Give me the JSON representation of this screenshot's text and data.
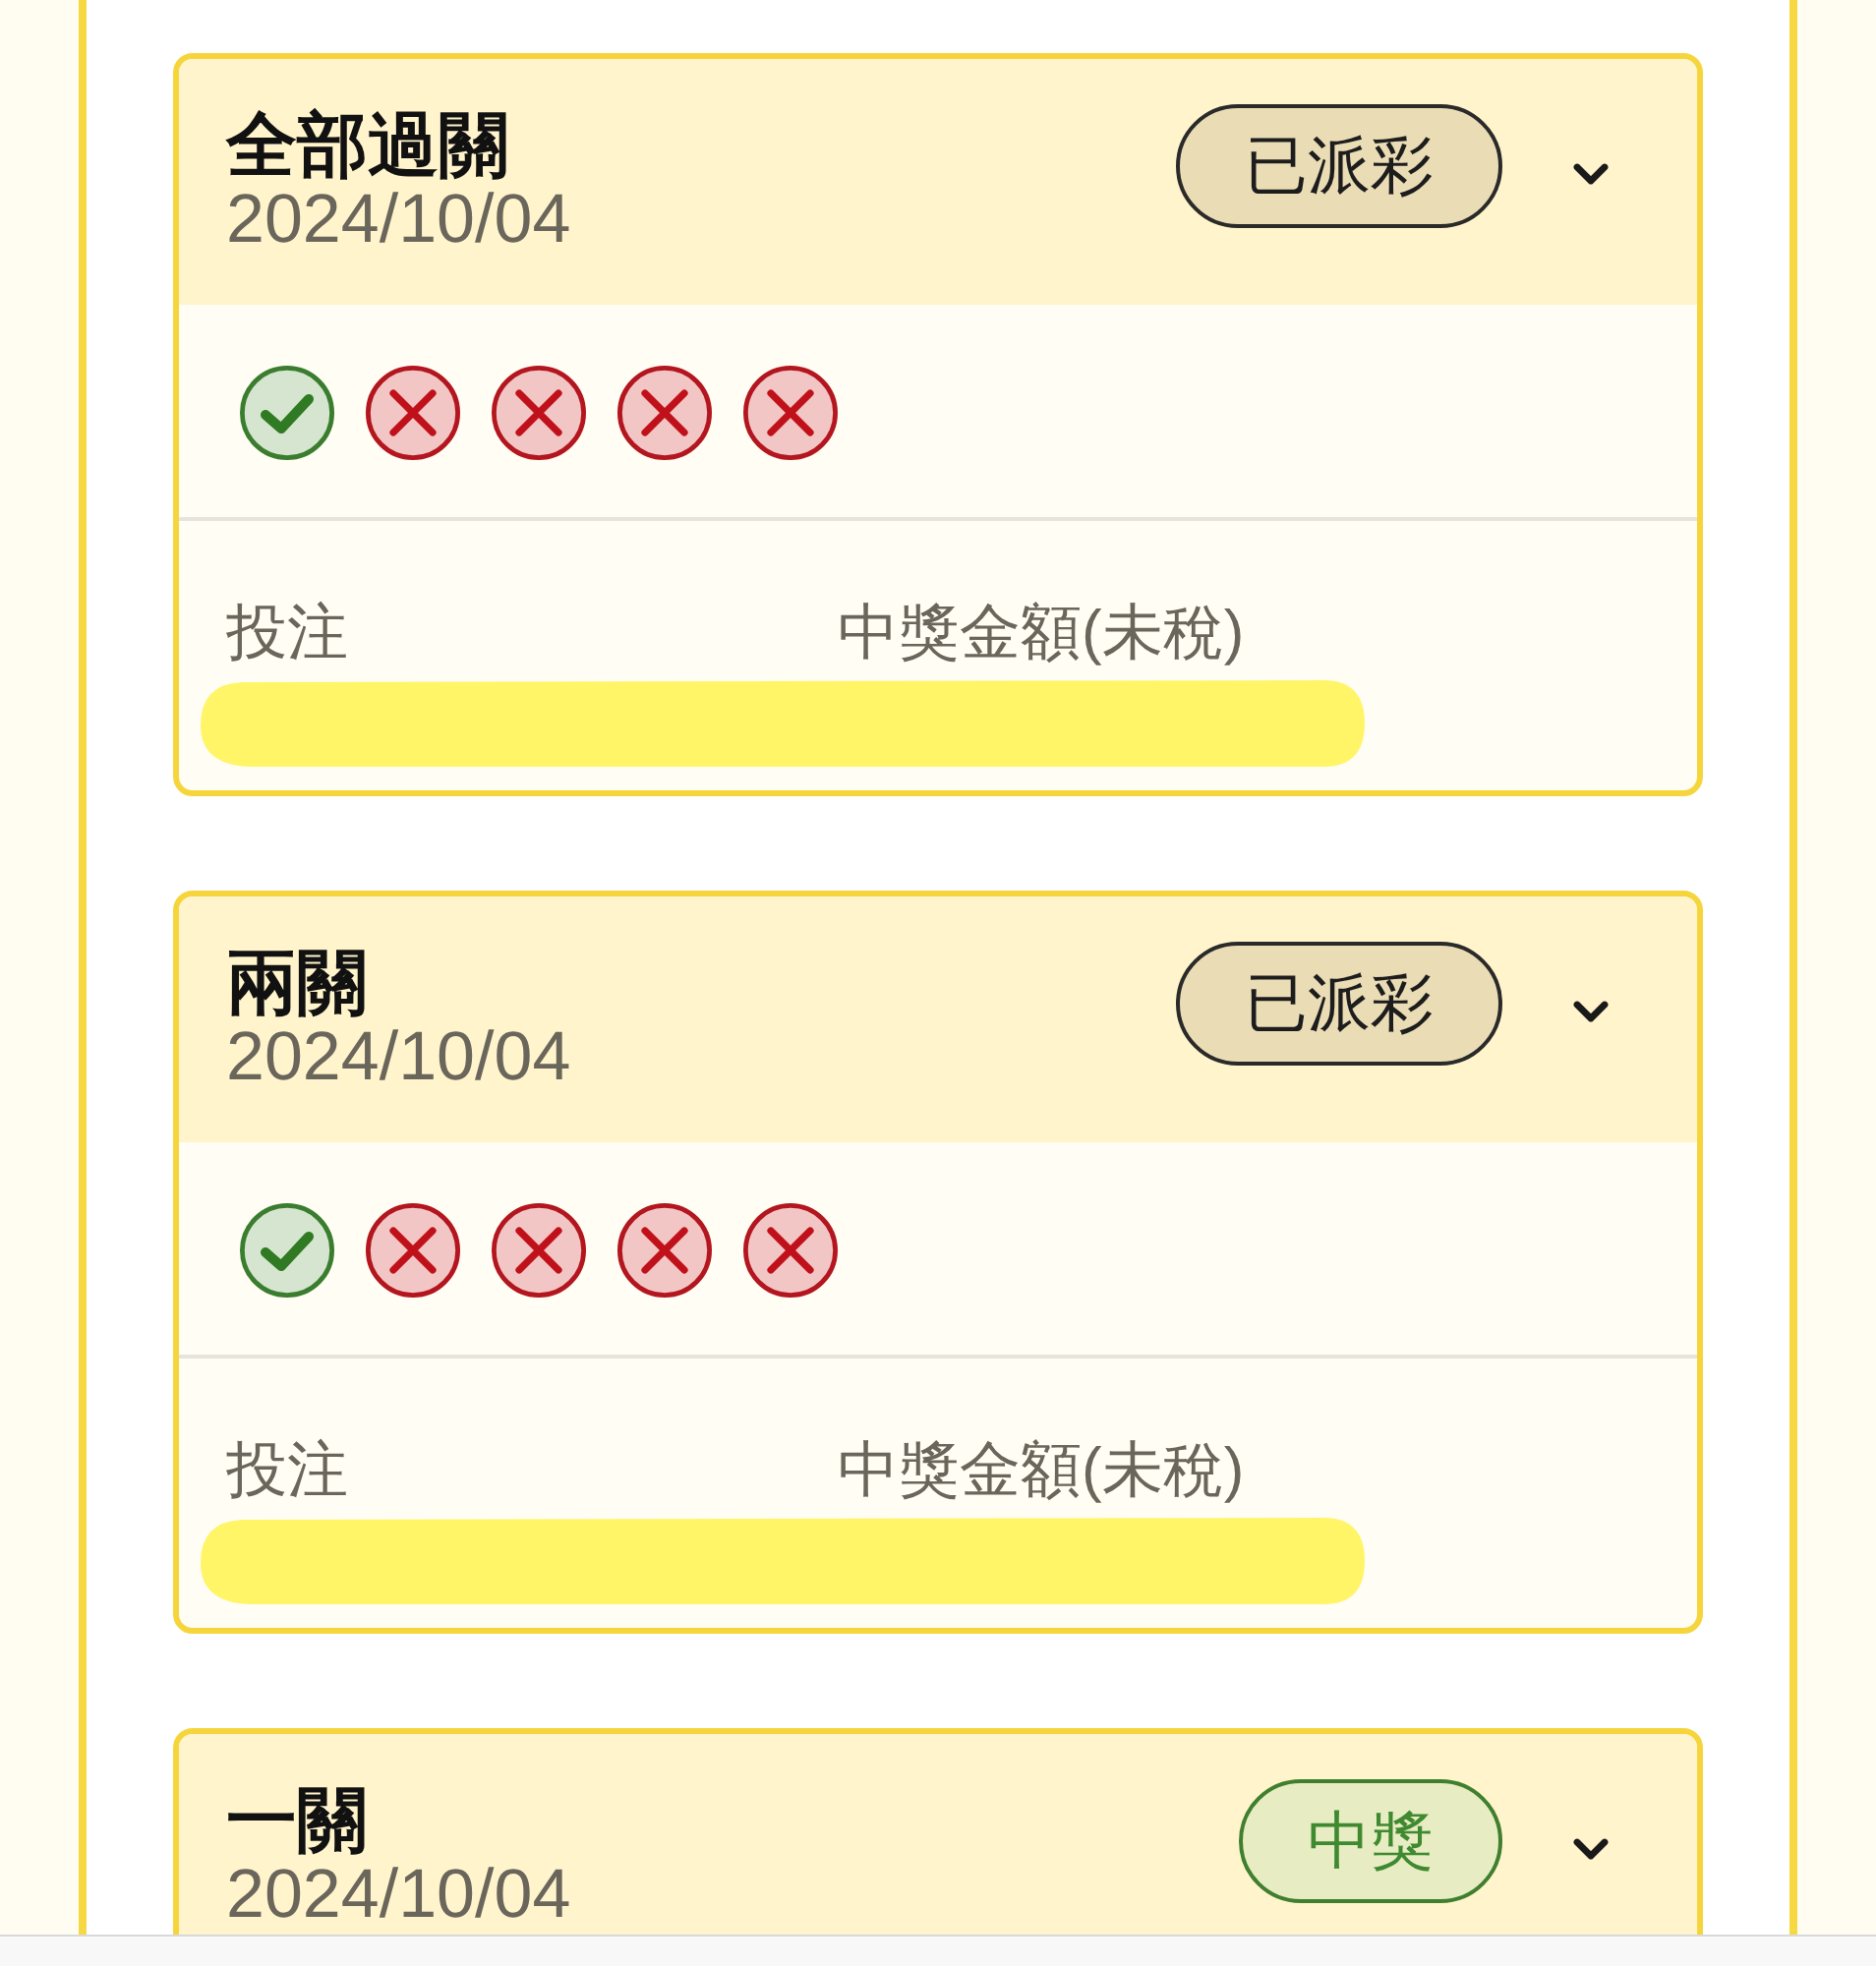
{
  "bets": [
    {
      "title": "全部過關",
      "date": "2024/10/04",
      "status": {
        "kind": "paid",
        "label": "已派彩"
      },
      "legs": [
        {
          "kind": "win"
        },
        {
          "kind": "lose"
        },
        {
          "kind": "lose"
        },
        {
          "kind": "lose"
        },
        {
          "kind": "lose"
        }
      ],
      "columns": [
        "投注",
        "中獎金額(未稅)"
      ]
    },
    {
      "title": "兩關",
      "date": "2024/10/04",
      "status": {
        "kind": "paid",
        "label": "已派彩"
      },
      "legs": [
        {
          "kind": "win"
        },
        {
          "kind": "lose"
        },
        {
          "kind": "lose"
        },
        {
          "kind": "lose"
        },
        {
          "kind": "lose"
        }
      ],
      "columns": [
        "投注",
        "中獎金額(未稅)"
      ]
    },
    {
      "title": "一關",
      "date": "2024/10/04",
      "status": {
        "kind": "won",
        "label": "中獎"
      }
    }
  ]
}
